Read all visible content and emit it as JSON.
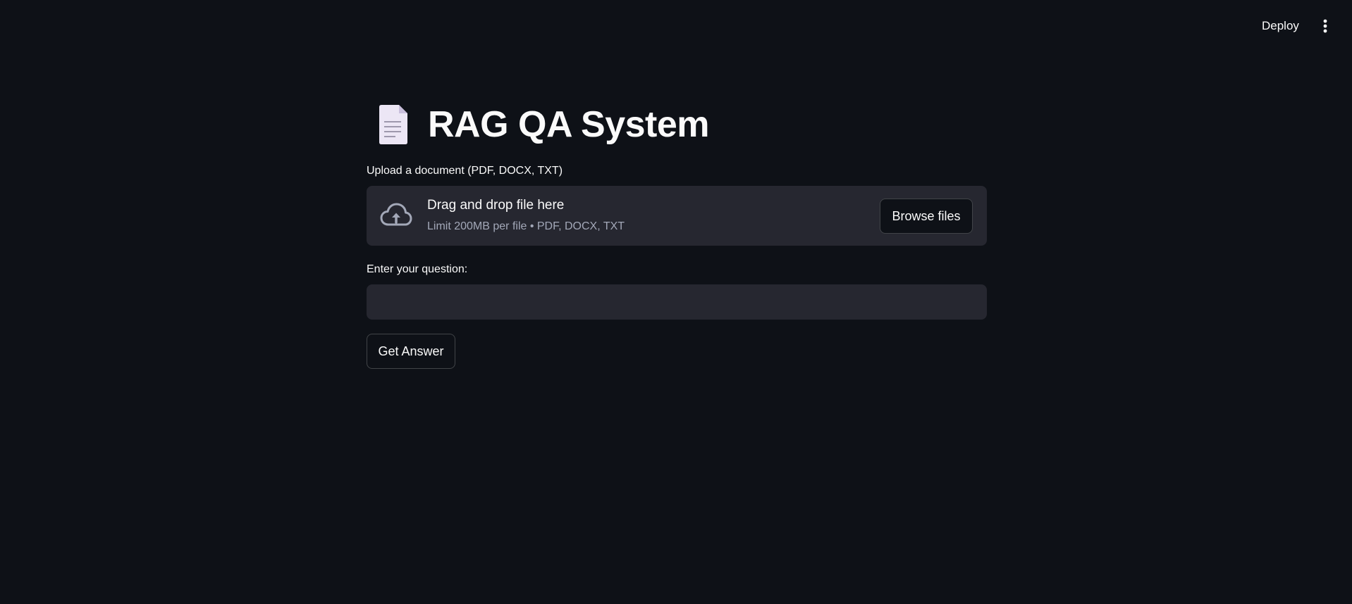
{
  "header": {
    "deploy_label": "Deploy",
    "menu_icon": "vertical-dots-icon"
  },
  "main": {
    "title_icon": "page-facing-up-icon",
    "title": "RAG QA System",
    "upload": {
      "label": "Upload a document (PDF, DOCX, TXT)",
      "icon": "cloud-upload-icon",
      "dropzone_title": "Drag and drop file here",
      "dropzone_subtitle": "Limit 200MB per file • PDF, DOCX, TXT",
      "browse_label": "Browse files"
    },
    "question": {
      "label": "Enter your question:",
      "value": "",
      "placeholder": ""
    },
    "submit_label": "Get Answer"
  },
  "colors": {
    "background": "#0e1117",
    "surface": "#262730",
    "text": "#fafafa",
    "muted_text": "#a3a8b8"
  }
}
